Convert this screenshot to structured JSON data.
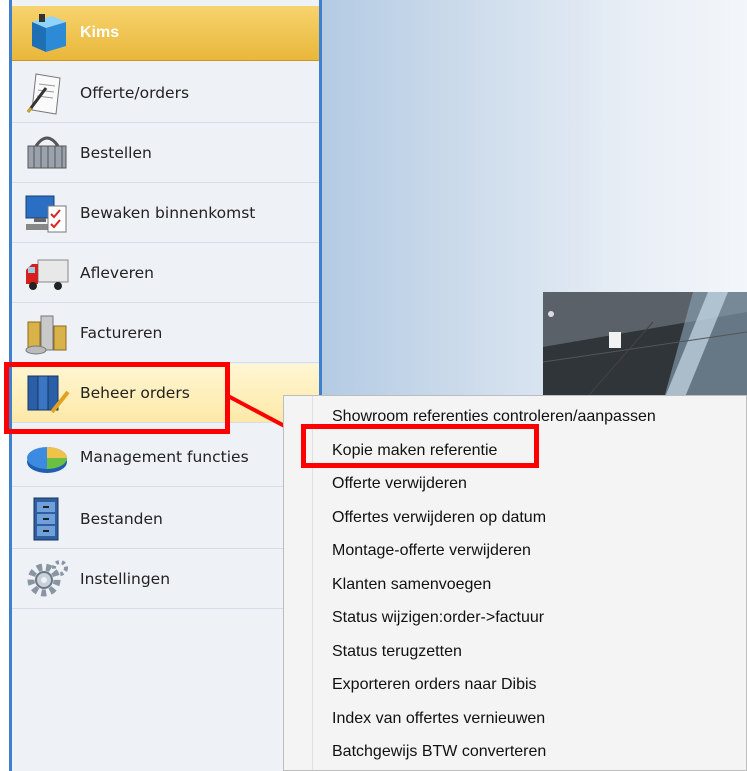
{
  "sidebar": {
    "header": {
      "label": "Kims"
    },
    "items": [
      {
        "label": "Offerte/orders",
        "icon": "document-pen-icon"
      },
      {
        "label": "Bestellen",
        "icon": "shopping-basket-icon"
      },
      {
        "label": "Bewaken binnenkomst",
        "icon": "computer-checklist-icon"
      },
      {
        "label": "Afleveren",
        "icon": "delivery-truck-icon"
      },
      {
        "label": "Factureren",
        "icon": "coins-icon"
      },
      {
        "label": "Beheer orders",
        "icon": "binders-icon"
      },
      {
        "label": "Management functies",
        "icon": "pie-chart-icon"
      },
      {
        "label": "Bestanden",
        "icon": "file-cabinet-icon"
      },
      {
        "label": "Instellingen",
        "icon": "gears-icon"
      }
    ]
  },
  "context_menu": {
    "items": [
      "Showroom referenties controleren/aanpassen",
      "Kopie maken referentie",
      "Offerte verwijderen",
      "Offertes verwijderen op datum",
      "Montage-offerte verwijderen",
      "Klanten samenvoegen",
      "Status wijzigen:order->factuur",
      "Status terugzetten",
      "Exporteren orders naar Dibis",
      "Index van offertes vernieuwen",
      "Batchgewijs BTW converteren"
    ]
  },
  "colors": {
    "header_gold": "#e9b73a",
    "highlight_red": "#ff0000",
    "sidebar_border_blue": "#3f7fd0"
  }
}
